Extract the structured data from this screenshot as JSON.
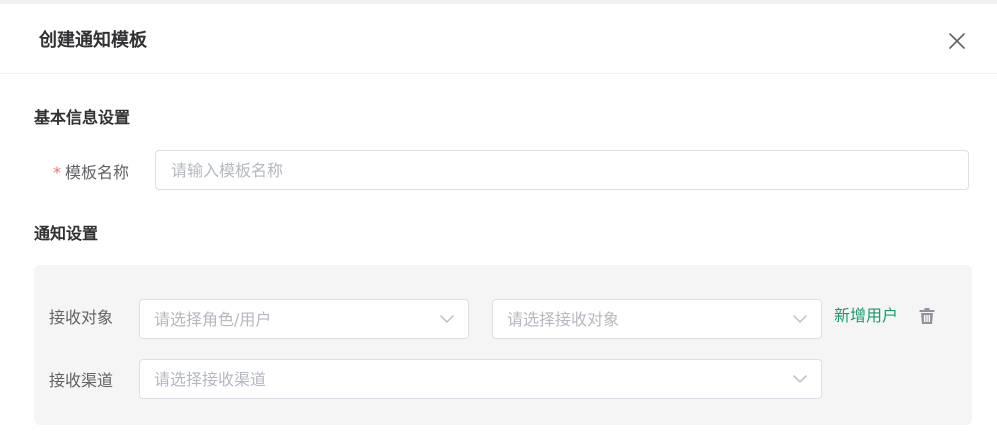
{
  "dialog": {
    "title": "创建通知模板",
    "close_icon": "close-icon"
  },
  "basic_section": {
    "title": "基本信息设置",
    "template_name": {
      "required_mark": "*",
      "label": "模板名称",
      "value": "",
      "placeholder": "请输入模板名称"
    }
  },
  "notify_section": {
    "title": "通知设置",
    "receiver": {
      "label": "接收对象",
      "role_select_placeholder": "请选择角色/用户",
      "target_select_placeholder": "请选择接收对象",
      "add_user_label": "新增用户",
      "delete_icon": "trash-icon"
    },
    "channel": {
      "label": "接收渠道",
      "select_placeholder": "请选择接收渠道"
    }
  },
  "colors": {
    "accent": "#1a9a6c",
    "required": "#f56c6c",
    "panel_bg": "#f5f5f5",
    "border": "#dcdfe6"
  }
}
